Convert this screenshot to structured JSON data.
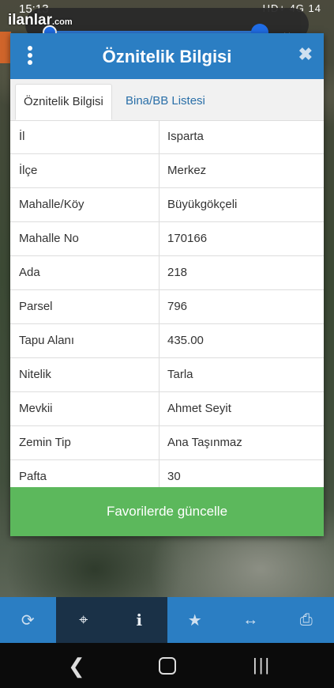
{
  "status_bar": {
    "time": "15:13",
    "right": "HD+ 4G 14"
  },
  "overlay": {
    "logo": "ilanlar",
    "logo_suffix": ".com"
  },
  "modal": {
    "title": "Öznitelik Bilgisi",
    "tabs": [
      {
        "label": "Öznitelik Bilgisi",
        "active": true
      },
      {
        "label": "Bina/BB Listesi",
        "active": false
      }
    ],
    "rows": [
      {
        "key": "İl",
        "value": "Isparta"
      },
      {
        "key": "İlçe",
        "value": "Merkez"
      },
      {
        "key": "Mahalle/Köy",
        "value": "Büyükgökçeli"
      },
      {
        "key": "Mahalle No",
        "value": "170166"
      },
      {
        "key": "Ada",
        "value": "218"
      },
      {
        "key": "Parsel",
        "value": "796"
      },
      {
        "key": "Tapu Alanı",
        "value": "435.00"
      },
      {
        "key": "Nitelik",
        "value": "Tarla"
      },
      {
        "key": "Mevkii",
        "value": "Ahmet Seyit"
      },
      {
        "key": "Zemin Tip",
        "value": "Ana Taşınmaz"
      },
      {
        "key": "Pafta",
        "value": "30"
      }
    ],
    "update_button": "Favorilerde güncelle"
  },
  "toolbar": {
    "icons": [
      "refresh-icon",
      "crosshair-icon",
      "info-icon",
      "star-icon",
      "measure-icon",
      "print-icon"
    ]
  },
  "colors": {
    "header_blue": "#2b7ec3",
    "button_green": "#5cb85c",
    "toolbar_dark": "#1a3147"
  }
}
